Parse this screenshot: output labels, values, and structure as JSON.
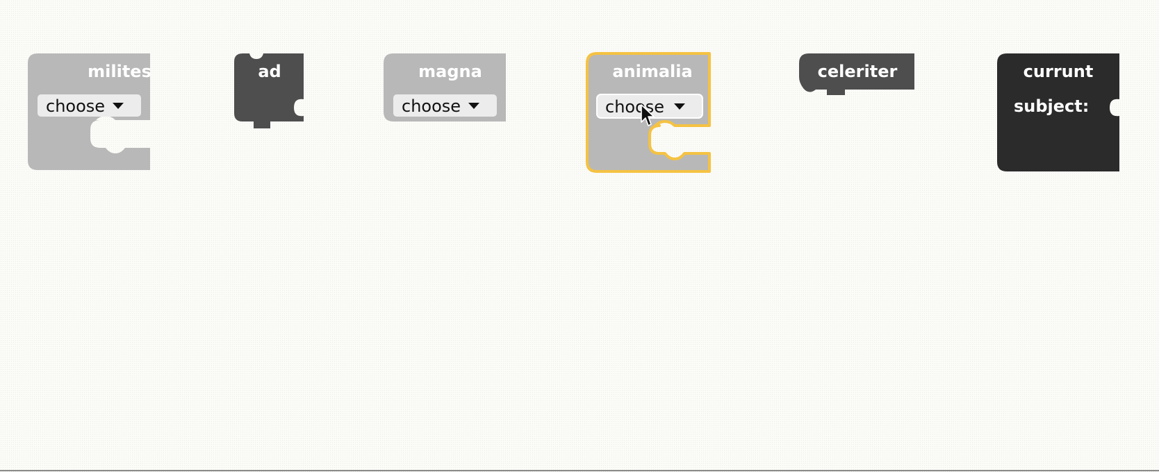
{
  "colors": {
    "workspace_bg": "#fbfbf8",
    "block_light": "#b8b8b8",
    "block_dark": "#4e4e4e",
    "block_black": "#2b2b2b",
    "selection": "#f5c242",
    "dropdown_bg": "#ececec"
  },
  "blocks": {
    "milites": {
      "title": "milites",
      "dropdown": "choose"
    },
    "ad": {
      "title": "ad"
    },
    "magna": {
      "title": "magna",
      "dropdown": "choose"
    },
    "animalia": {
      "title": "animalia",
      "dropdown": "choose",
      "selected": true
    },
    "celeriter": {
      "title": "celeriter"
    },
    "currunt": {
      "title": "currunt",
      "input_label": "subject:"
    }
  }
}
